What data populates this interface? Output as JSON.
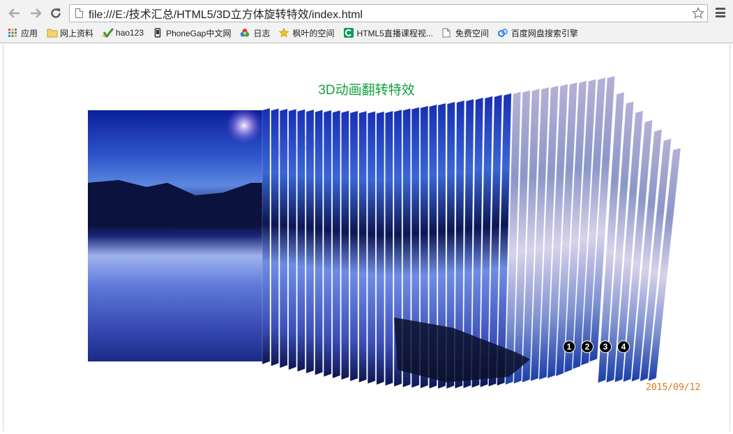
{
  "browser": {
    "url": "file:///E:/技术汇总/HTML5/3D立方体旋转特效/index.html",
    "icons": {
      "back": "back-arrow-icon",
      "forward": "forward-arrow-icon",
      "reload": "reload-icon",
      "bookmark_star": "star-icon",
      "menu": "hamburger-menu-icon"
    }
  },
  "bookmarks": [
    {
      "label": "应用",
      "icon": "apps-grid-icon"
    },
    {
      "label": "网上资料",
      "icon": "folder-icon"
    },
    {
      "label": "hao123",
      "icon": "hao123-icon"
    },
    {
      "label": "PhoneGap中文网",
      "icon": "phonegap-icon"
    },
    {
      "label": "日志",
      "icon": "qzone-icon"
    },
    {
      "label": "枫叶的空间",
      "icon": "star-badge-icon"
    },
    {
      "label": "HTML5直播课程视...",
      "icon": "c-logo-icon"
    },
    {
      "label": "免费空间",
      "icon": "page-icon"
    },
    {
      "label": "百度网盘搜索引擎",
      "icon": "baidu-pan-icon"
    }
  ],
  "page": {
    "title": "3D动画翻转特效",
    "date": "2015/09/12",
    "pager": [
      "1",
      "2",
      "3",
      "4"
    ],
    "colors": {
      "title": "#13a23b",
      "date": "#d97a1a",
      "sky_top": "#0c1f9c",
      "sky_light": "#4f7de0",
      "water": "#5e79d8",
      "mountain": "#0a123d"
    }
  }
}
